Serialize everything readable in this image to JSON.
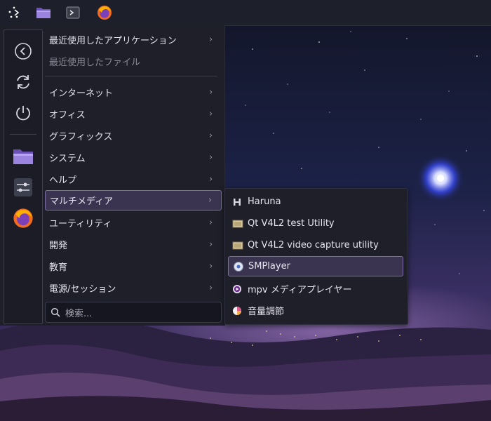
{
  "panel": {
    "items": [
      {
        "name": "application-launcher-icon"
      },
      {
        "name": "file-manager-icon"
      },
      {
        "name": "terminal-icon"
      },
      {
        "name": "firefox-icon"
      }
    ]
  },
  "favorites": [
    {
      "name": "back-icon"
    },
    {
      "name": "refresh-icon"
    },
    {
      "name": "power-icon"
    },
    {
      "name": "file-manager-icon"
    },
    {
      "name": "settings-icon"
    },
    {
      "name": "firefox-icon"
    }
  ],
  "menu": {
    "recent_apps": "最近使用したアプリケーション",
    "recent_files": "最近使用したファイル",
    "categories": [
      {
        "label": "インターネット"
      },
      {
        "label": "オフィス"
      },
      {
        "label": "グラフィックス"
      },
      {
        "label": "システム"
      },
      {
        "label": "ヘルプ"
      },
      {
        "label": "マルチメディア",
        "active": true
      },
      {
        "label": "ユーティリティ"
      },
      {
        "label": "開発"
      },
      {
        "label": "教育"
      },
      {
        "label": "電源/セッション"
      }
    ],
    "chevron": "›",
    "search_placeholder": "検索..."
  },
  "submenu": {
    "items": [
      {
        "label": "Haruna",
        "icon": "haruna-icon"
      },
      {
        "label": "Qt V4L2 test Utility",
        "icon": "qt-v4l2-icon"
      },
      {
        "label": "Qt V4L2 video capture utility",
        "icon": "qt-v4l2-capture-icon"
      },
      {
        "label": "SMPlayer",
        "icon": "smplayer-icon",
        "active": true
      },
      {
        "label": "mpv メディアプレイヤー",
        "icon": "mpv-icon"
      },
      {
        "label": "音量調節",
        "icon": "volume-control-icon"
      }
    ]
  },
  "colors": {
    "accent": "#7d6ea6",
    "panel_bg": "#1d1f2b",
    "menu_bg": "#1e1f29",
    "folder": "#8a6fd1",
    "firefox_orange": "#f26b1f"
  }
}
